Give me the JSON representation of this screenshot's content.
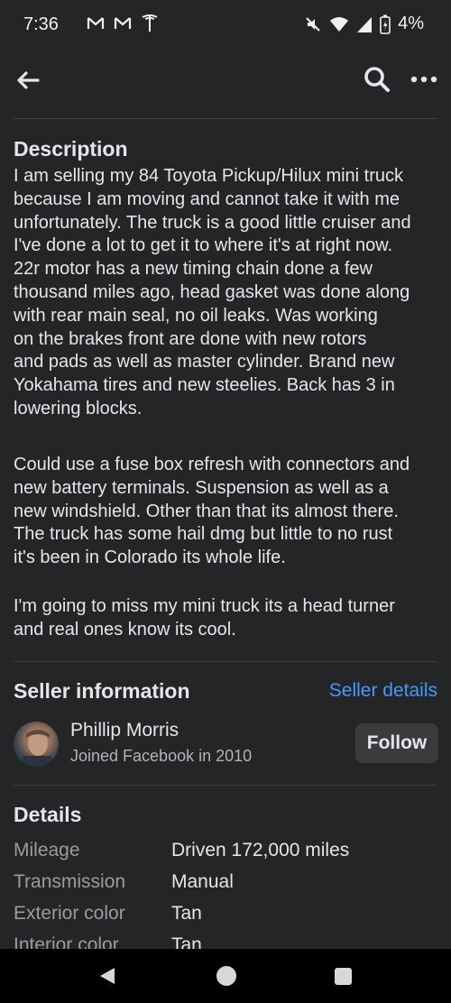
{
  "status_bar": {
    "time": "7:36",
    "battery": "4%",
    "left_icons": [
      "gmail-icon",
      "gmail-icon",
      "tesla-icon"
    ],
    "right_icons": [
      "mute-icon",
      "wifi-icon",
      "signal-icon",
      "battery-charging-icon"
    ]
  },
  "toolbar": {
    "back_icon": "back-arrow-icon",
    "search_icon": "search-icon",
    "more_icon": "more-icon"
  },
  "description": {
    "heading": "Description",
    "paragraph1": "I am selling my 84 Toyota Pickup/Hilux mini truck\nbecause I am moving and cannot take it with me\nunfortunately. The truck is a good little cruiser and\nI've done a lot to get it to where it's at right now.\n22r motor has a new timing chain done a few\nthousand miles ago, head gasket was done along\nwith rear main seal, no oil leaks. Was working\non the brakes front are done with new rotors\nand pads as well as master cylinder. Brand new\nYokahama tires and new steelies. Back has 3 in\nlowering blocks.",
    "paragraph2": "Could use a fuse box refresh with connectors and\nnew battery terminals. Suspension as well as a\nnew windshield. Other than that its almost there.\nThe truck has some hail dmg but little to no rust\nit's been in Colorado its whole life.",
    "paragraph3": "I'm going to miss my mini truck its a head turner\nand real ones know its cool."
  },
  "seller": {
    "heading": "Seller information",
    "details_link": "Seller details",
    "name": "Phillip Morris",
    "joined": "Joined Facebook in 2010",
    "follow_label": "Follow"
  },
  "details": {
    "heading": "Details",
    "rows": [
      {
        "label": "Mileage",
        "value": "Driven 172,000 miles"
      },
      {
        "label": "Transmission",
        "value": "Manual"
      },
      {
        "label": "Exterior color",
        "value": "Tan"
      },
      {
        "label": "Interior color",
        "value": "Tan"
      }
    ]
  },
  "colors": {
    "background": "#242526",
    "link": "#4599ff",
    "button": "#3a3b3c",
    "muted_text": "#9a9ca1"
  }
}
